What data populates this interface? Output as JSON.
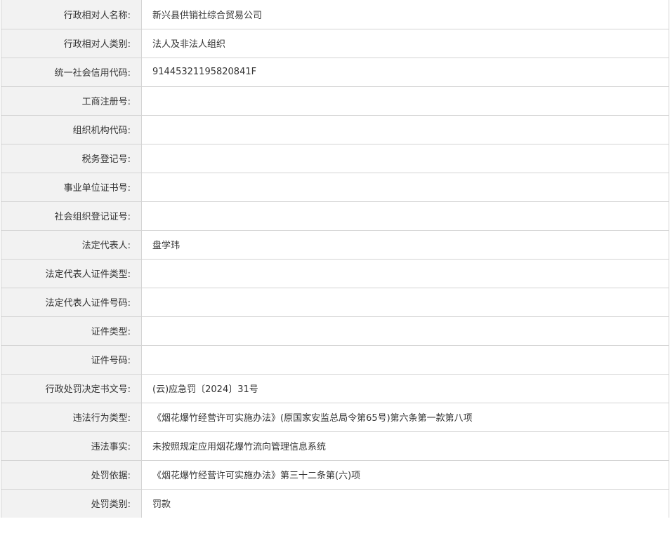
{
  "record": {
    "rows": [
      {
        "label": "行政相对人名称:",
        "value": "新兴县供销社综合贸易公司"
      },
      {
        "label": "行政相对人类别:",
        "value": "法人及非法人组织"
      },
      {
        "label": "统一社会信用代码:",
        "value": "91445321195820841F"
      },
      {
        "label": "工商注册号:",
        "value": ""
      },
      {
        "label": "组织机构代码:",
        "value": ""
      },
      {
        "label": "税务登记号:",
        "value": ""
      },
      {
        "label": "事业单位证书号:",
        "value": ""
      },
      {
        "label": "社会组织登记证号:",
        "value": ""
      },
      {
        "label": "法定代表人:",
        "value": "盘学玮"
      },
      {
        "label": "法定代表人证件类型:",
        "value": ""
      },
      {
        "label": "法定代表人证件号码:",
        "value": ""
      },
      {
        "label": "证件类型:",
        "value": ""
      },
      {
        "label": "证件号码:",
        "value": ""
      },
      {
        "label": "行政处罚决定书文号:",
        "value": "(云)应急罚〔2024〕31号"
      },
      {
        "label": "违法行为类型:",
        "value": "《烟花爆竹经营许可实施办法》(原国家安监总局令第65号)第六条第一款第八项"
      },
      {
        "label": "违法事实:",
        "value": "未按照规定应用烟花爆竹流向管理信息系统"
      },
      {
        "label": "处罚依据:",
        "value": "《烟花爆竹经营许可实施办法》第三十二条第(六)项"
      },
      {
        "label": "处罚类别:",
        "value": "罚款"
      }
    ]
  }
}
